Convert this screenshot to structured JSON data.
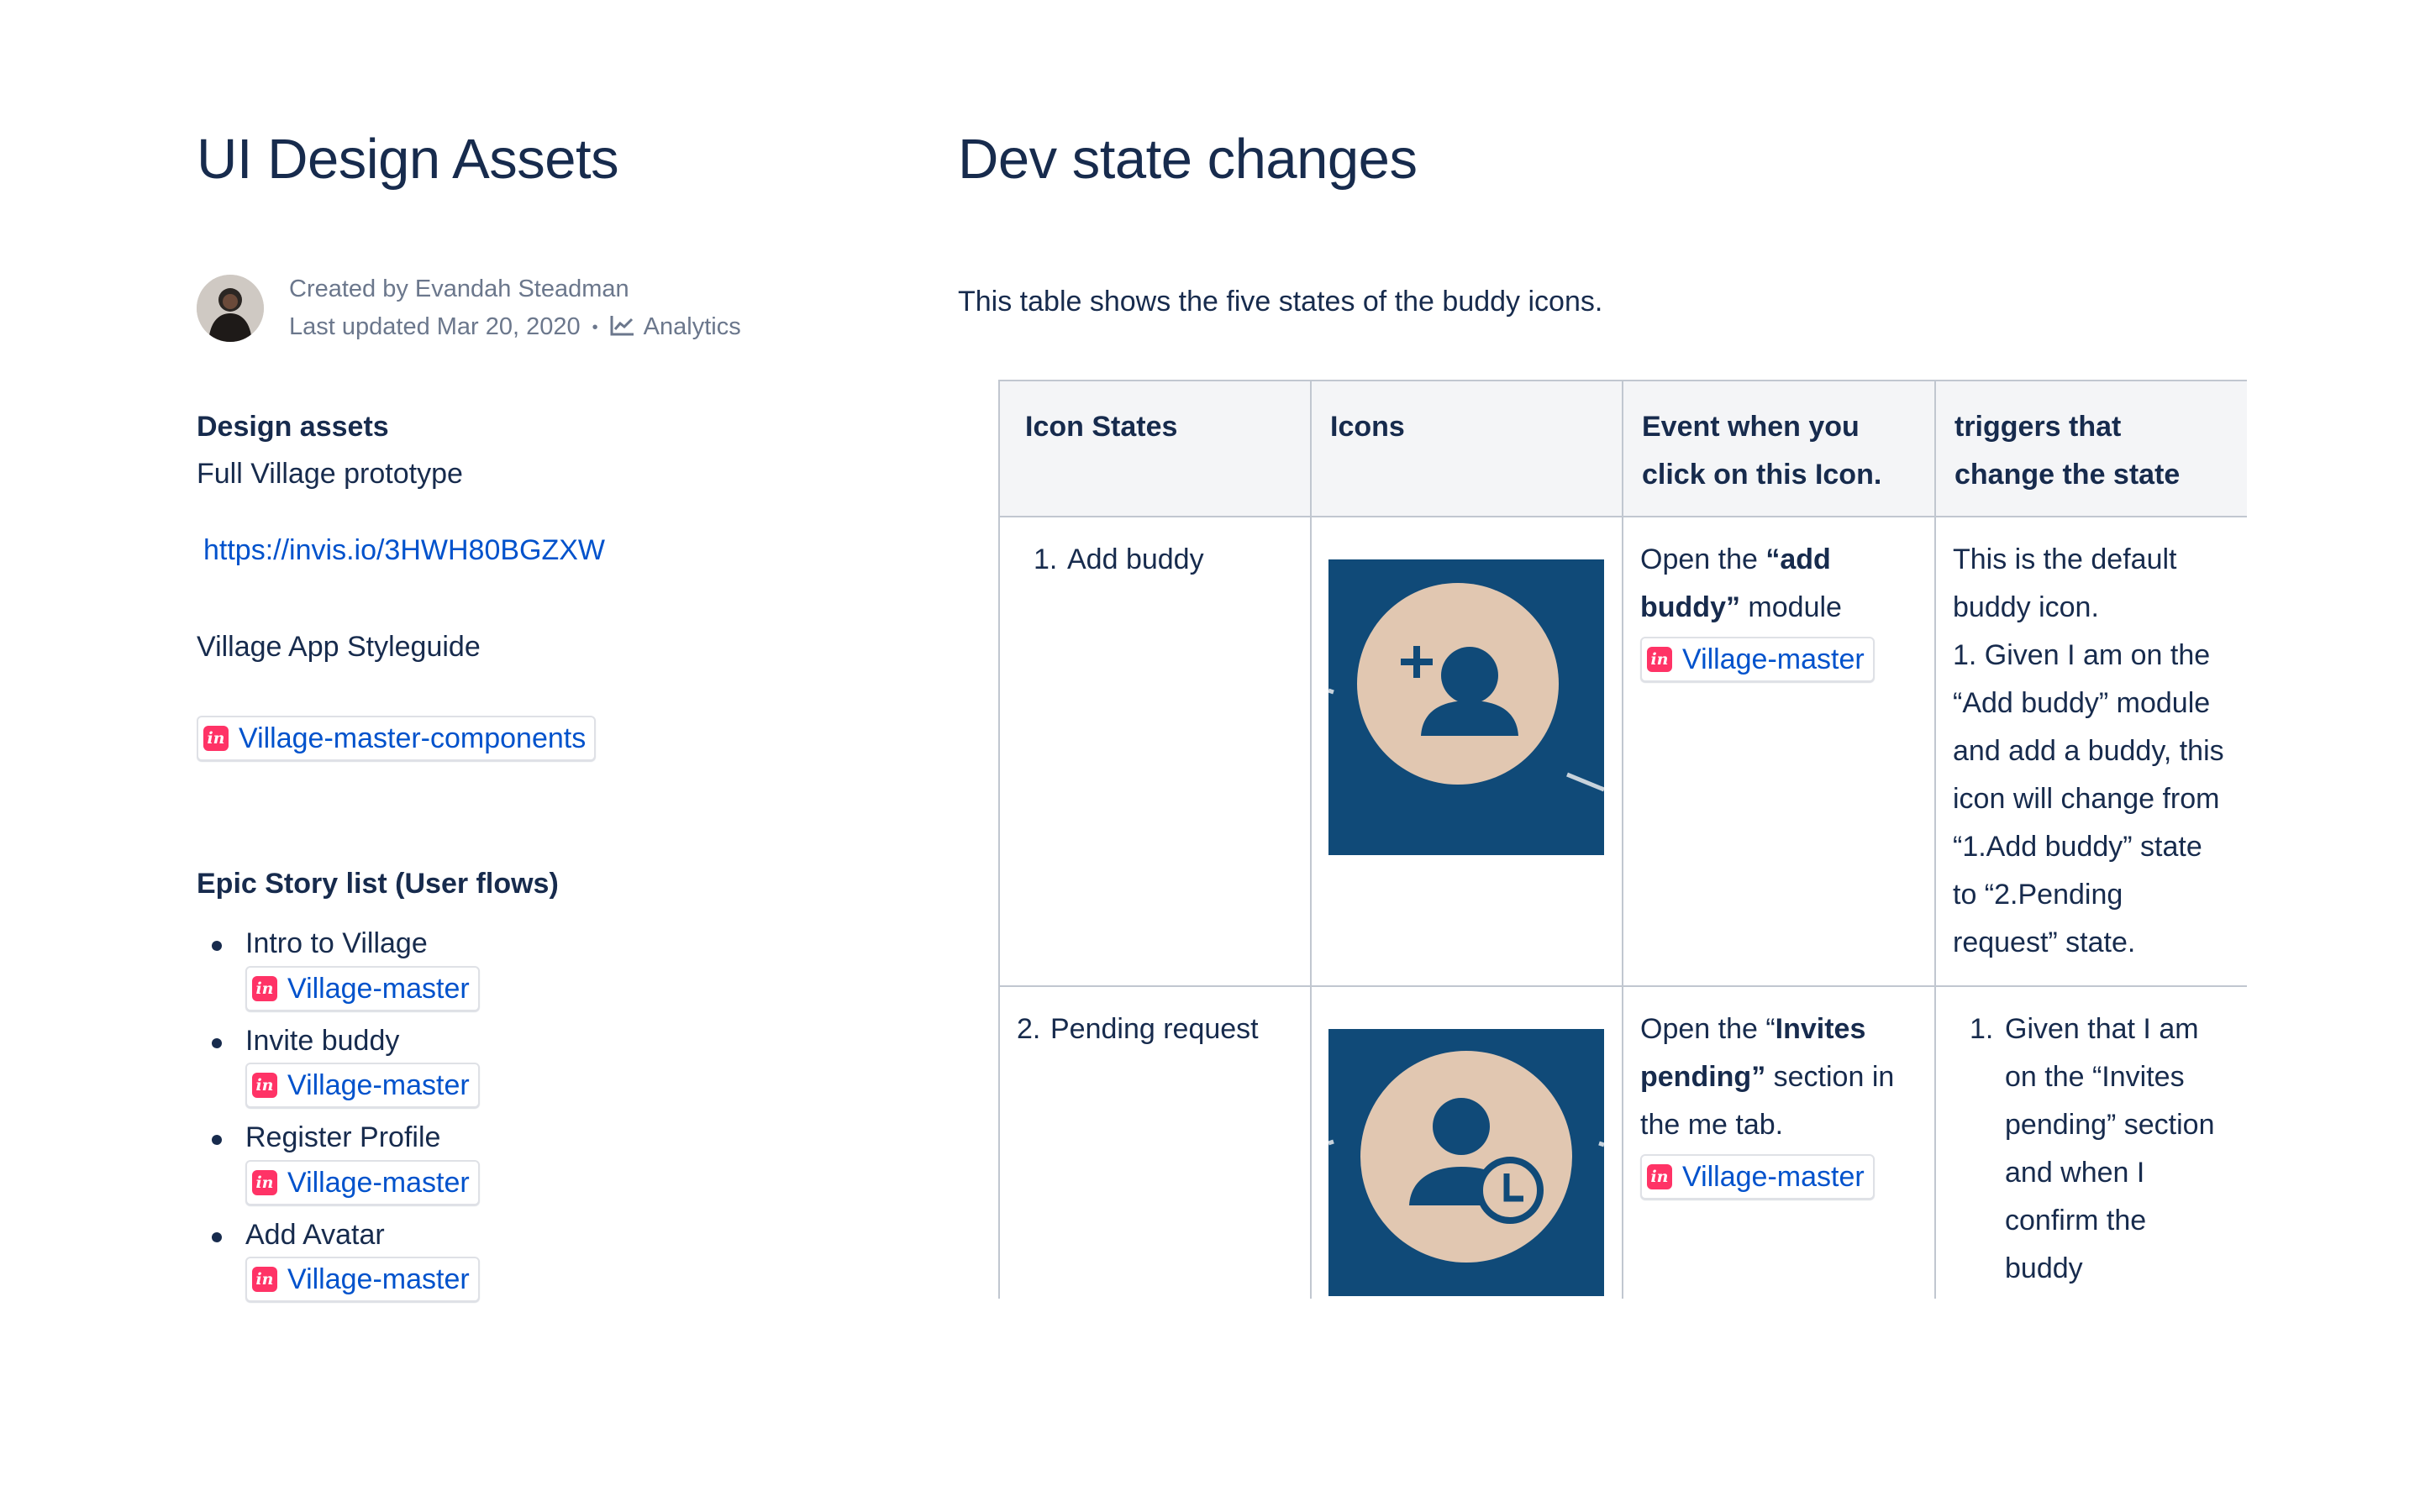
{
  "left": {
    "title": "UI Design Assets",
    "byline": {
      "created_by": "Created by Evandah Steadman",
      "last_updated": "Last updated Mar 20, 2020",
      "analytics": "Analytics"
    },
    "design_assets": {
      "heading": "Design assets",
      "prototype_label": "Full Village prototype",
      "prototype_url": "https://invis.io/3HWH80BGZXW",
      "styleguide_label": "Village App Styleguide",
      "components_link": "Village-master-components"
    },
    "epic": {
      "heading": "Epic Story list (User flows)",
      "items": [
        {
          "label": "Intro to Village",
          "link": "Village-master"
        },
        {
          "label": "Invite buddy",
          "link": "Village-master"
        },
        {
          "label": "Register Profile",
          "link": "Village-master"
        },
        {
          "label": "Add Avatar",
          "link": "Village-master"
        }
      ]
    }
  },
  "right": {
    "title": "Dev state changes",
    "intro": "This table shows the five states of the buddy icons.",
    "table": {
      "headers": [
        "Icon States",
        "Icons",
        "Event when you click on this Icon.",
        "triggers that change the state"
      ],
      "rows": [
        {
          "state_num": "1.",
          "state_label": "Add buddy",
          "icon": "add-buddy-icon",
          "event_pre": "Open the ",
          "event_bold": "“add buddy”",
          "event_post": " module",
          "event_link": "Village-master",
          "trigger_intro": "This is the default buddy icon.",
          "trigger_detail": "1. Given I am on the “Add buddy” module and add a buddy, this icon will change from “1.Add buddy” state to “2.Pending request” state."
        },
        {
          "state_num": "2.",
          "state_label": "Pending request",
          "icon": "pending-request-icon",
          "event_pre": "Open the “",
          "event_bold": "Invites pending”",
          "event_post": " section in the me tab.",
          "event_link": "Village-master",
          "trigger_num": "1.",
          "trigger_detail": "Given that I am on  the “Invites pending” section and when I confirm the buddy"
        }
      ]
    }
  },
  "colors": {
    "text": "#172b4d",
    "link": "#0052cc",
    "meta": "#6b778c",
    "icon_tile": "#104a78",
    "icon_circle": "#e1c7b1",
    "invision": "#ff3366"
  }
}
